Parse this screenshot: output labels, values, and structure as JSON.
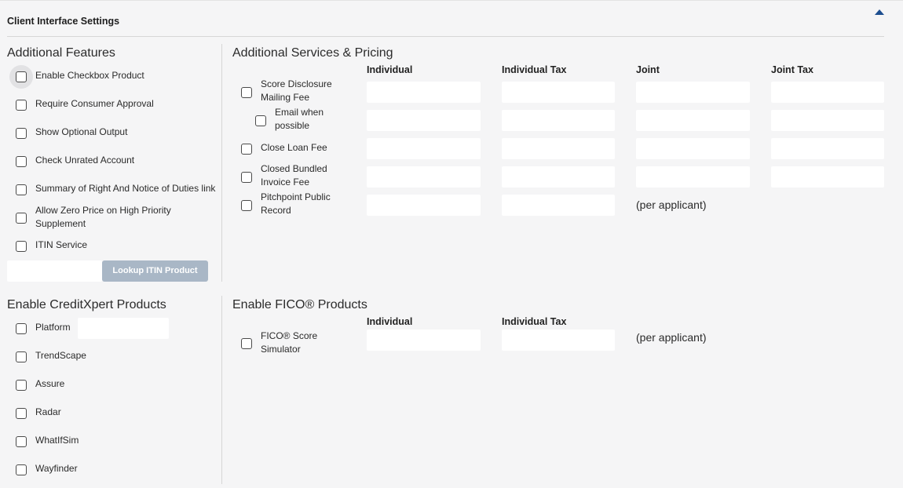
{
  "header": {
    "title": "Client Interface Settings",
    "collapse_icon": "chevron-up-icon",
    "accent_color": "#1d4e8f"
  },
  "additional_features": {
    "title": "Additional Features",
    "items": [
      {
        "label": "Enable Checkbox Product",
        "checked": false
      },
      {
        "label": "Require Consumer Approval",
        "checked": false
      },
      {
        "label": "Show Optional Output",
        "checked": false
      },
      {
        "label": "Check Unrated Account",
        "checked": false
      },
      {
        "label": "Summary of Right And Notice of Duties link",
        "checked": false
      },
      {
        "label": "Allow Zero Price on High Priority\nSupplement",
        "checked": false
      },
      {
        "label": "ITIN Service",
        "checked": false
      }
    ],
    "itin_input_value": "",
    "lookup_button_label": "Lookup ITIN Product",
    "lookup_button_color": "#a9b7c6"
  },
  "services": {
    "title": "Additional Services & Pricing",
    "columns": [
      "Individual",
      "Individual Tax",
      "Joint",
      "Joint Tax"
    ],
    "rows": [
      {
        "label": "Score Disclosure\nMailing Fee",
        "checked": false,
        "values": [
          "",
          "",
          "",
          ""
        ]
      },
      {
        "label": "Email when\npossible",
        "checked": false,
        "values": [
          "",
          "",
          "",
          ""
        ]
      },
      {
        "label": "Close Loan Fee",
        "checked": false,
        "values": [
          "",
          "",
          "",
          ""
        ]
      },
      {
        "label": "Closed Bundled\nInvoice Fee",
        "checked": false,
        "values": [
          "",
          "",
          "",
          ""
        ]
      },
      {
        "label": "Pitchpoint Public\nRecord",
        "checked": false,
        "values": [
          "",
          ""
        ],
        "note": "(per applicant)"
      }
    ]
  },
  "creditxpert": {
    "title": "Enable CreditXpert Products",
    "items": [
      {
        "label": "Platform",
        "checked": false
      },
      {
        "label": "TrendScape",
        "checked": false
      },
      {
        "label": "Assure",
        "checked": false
      },
      {
        "label": "Radar",
        "checked": false
      },
      {
        "label": "WhatIfSim",
        "checked": false
      },
      {
        "label": "Wayfinder",
        "checked": false
      }
    ],
    "platform_input_value": ""
  },
  "fico": {
    "title": "Enable FICO® Products",
    "columns": [
      "Individual",
      "Individual Tax"
    ],
    "rows": [
      {
        "label": "FICO® Score\nSimulator",
        "checked": false,
        "values": [
          "",
          ""
        ],
        "note": "(per applicant)"
      }
    ]
  }
}
